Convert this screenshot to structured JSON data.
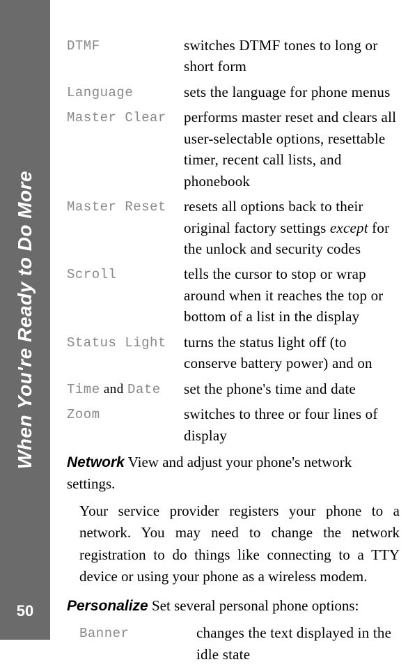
{
  "sidebar": {
    "title": "When You're Ready to Do More"
  },
  "page_number": "50",
  "rows1": [
    {
      "term": "DTMF",
      "desc": "switches DTMF tones to long or short form"
    },
    {
      "term": "Language",
      "desc": "sets the language for phone menus"
    },
    {
      "term": "Master Clear",
      "desc": "performs master reset and clears all user-selectable options, resettable timer, recent call lists, and phonebook"
    },
    {
      "term": "Master Reset",
      "desc_pre": "resets all options back to their original factory settings ",
      "italic": "except",
      "desc_post": " for the unlock and security codes"
    },
    {
      "term": "Scroll",
      "desc": "tells the cursor to stop or wrap around when it reaches the top or bottom of a list in the display"
    },
    {
      "term": "Status Light",
      "desc": "turns the status light off (to conserve battery power) and on"
    },
    {
      "term_pre": "Time",
      "term_and": " and ",
      "term_post": "Date",
      "desc": "set the phone's time and date"
    },
    {
      "term": "Zoom",
      "desc": "switches to three or four lines of display"
    }
  ],
  "network": {
    "heading": "Network",
    "intro": "  View and adjust your phone's network settings.",
    "body": "Your service provider registers your phone to a network. You may need to change the network registration to do things like connecting to a TTY device or using your phone as a wireless modem."
  },
  "personalize": {
    "heading": "Personalize",
    "intro": "  Set several personal phone options:"
  },
  "rows2": [
    {
      "term": "Banner",
      "desc": "changes the text displayed in the idle state"
    }
  ]
}
